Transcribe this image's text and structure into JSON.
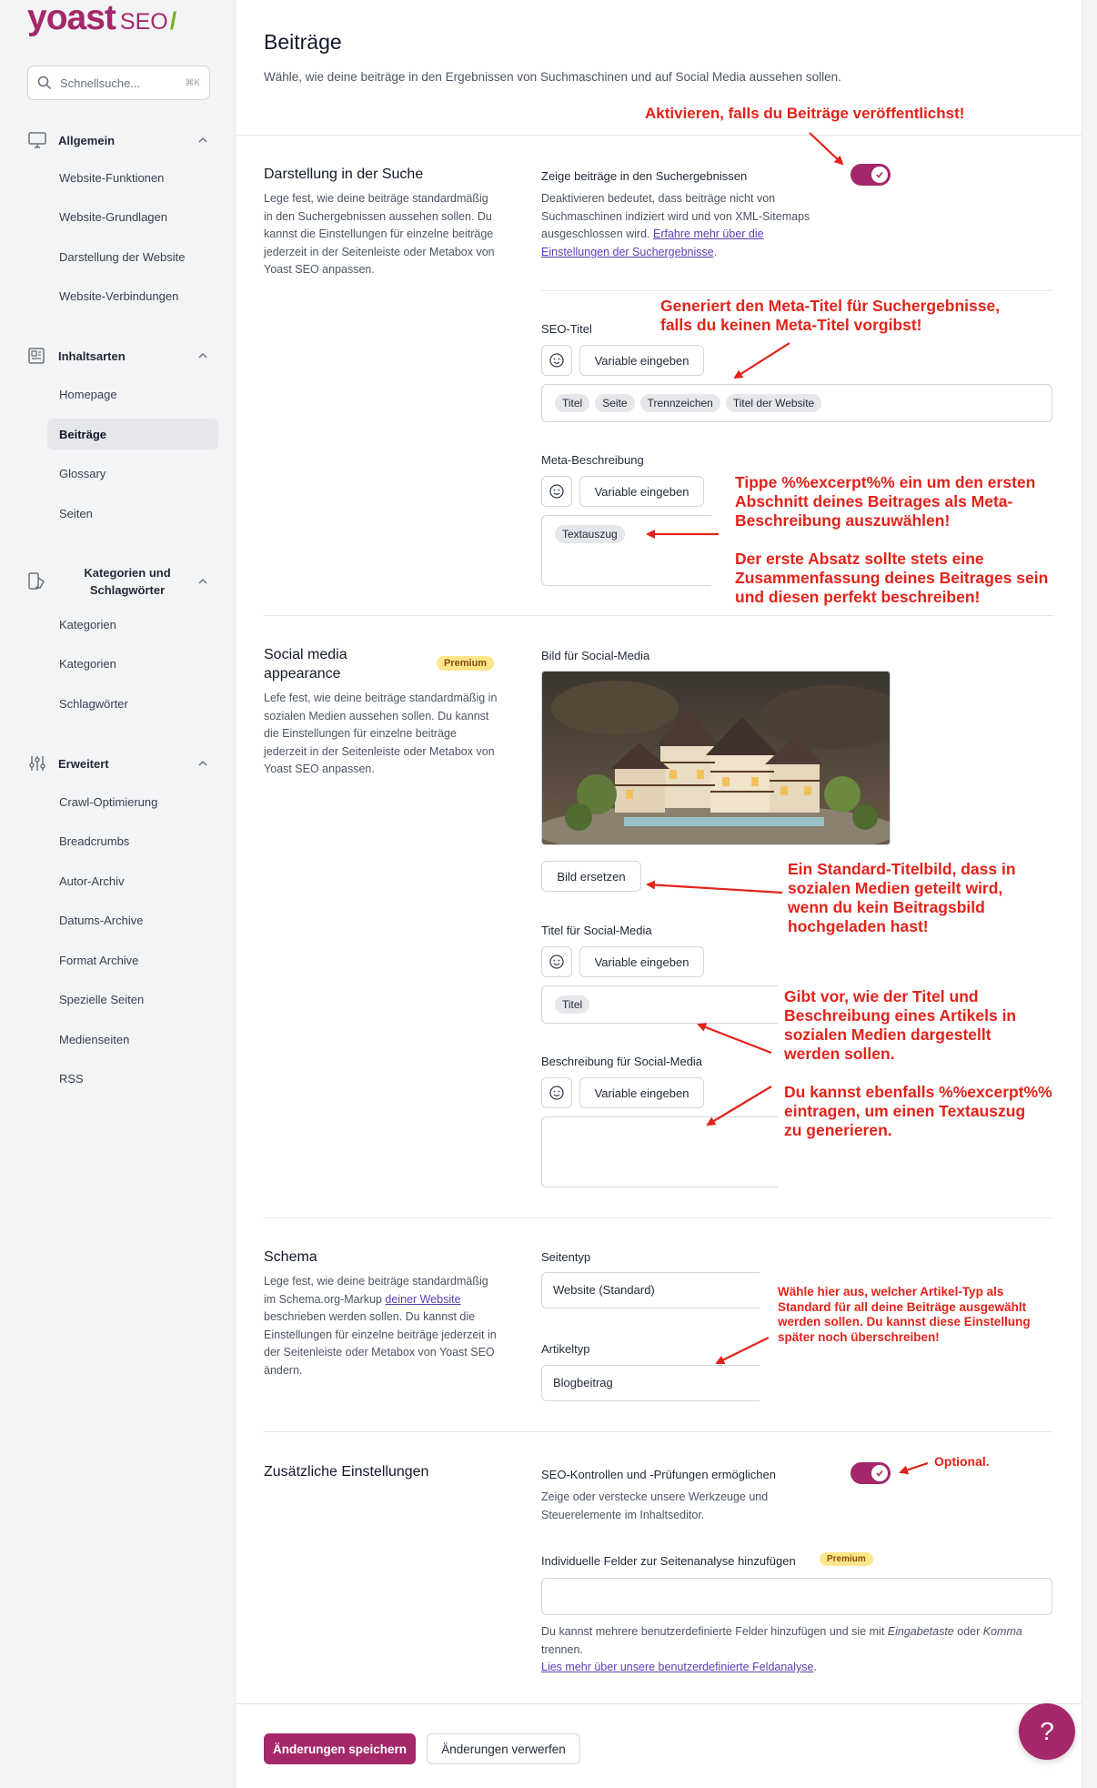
{
  "brand": {
    "logo_main": "yoast",
    "logo_sub": "SEO",
    "logo_slash": "/"
  },
  "search": {
    "placeholder": "Schnellsuche...",
    "shortcut": "⌘K"
  },
  "sidebar": {
    "sections": [
      {
        "label": "Allgemein",
        "icon": "desktop-icon",
        "items": [
          "Website-Funktionen",
          "Website-Grundlagen",
          "Darstellung der Website",
          "Website-Verbindungen"
        ]
      },
      {
        "label": "Inhaltsarten",
        "icon": "newspaper-icon",
        "items": [
          "Homepage",
          "Beiträge",
          "Glossary",
          "Seiten"
        ]
      },
      {
        "label_line1": "Kategorien und",
        "label_line2": "Schlagwörter",
        "icon": "tag-icon",
        "items": [
          "Kategorien",
          "Kategorien",
          "Schlagwörter"
        ]
      },
      {
        "label": "Erweitert",
        "icon": "sliders-icon",
        "items": [
          "Crawl-Optimierung",
          "Breadcrumbs",
          "Autor-Archiv",
          "Datums-Archive",
          "Format Archive",
          "Spezielle Seiten",
          "Medienseiten",
          "RSS"
        ]
      }
    ],
    "active_item": "Beiträge"
  },
  "page": {
    "title": "Beiträge",
    "description": "Wähle, wie deine beiträge in den Ergebnissen von Suchmaschinen und auf Social Media aussehen sollen."
  },
  "search_appearance": {
    "title": "Darstellung in der Suche",
    "description": "Lege fest, wie deine beiträge standardmäßig in den Suchergebnissen aussehen sollen. Du kannst die Einstellungen für einzelne beiträge jederzeit in der Seitenleiste oder Metabox von Yoast SEO anpassen.",
    "toggle_label": "Zeige beiträge in den Suchergebnissen",
    "toggle_on": true,
    "toggle_desc": "Deaktivieren bedeutet, dass beiträge nicht von Suchmaschinen indiziert wird und von XML-Sitemaps ausgeschlossen wird.",
    "toggle_link": "Erfahre mehr über die Einstellungen der Suchergebnisse",
    "seo_title_label": "SEO-Titel",
    "insert_variable": "Variable eingeben",
    "seo_title_tags": [
      "Titel",
      "Seite",
      "Trennzeichen",
      "Titel der Website"
    ],
    "meta_label": "Meta-Beschreibung",
    "meta_tags": [
      "Textauszug"
    ]
  },
  "social": {
    "title": "Social media appearance",
    "badge": "Premium",
    "description": "Lefe fest, wie deine beiträge standardmäßig in sozialen Medien aussehen sollen. Du kannst die Einstellungen für einzelne beiträge jederzeit in der Seitenleiste oder Metabox von Yoast SEO anpassen.",
    "image_label": "Bild für Social-Media",
    "replace_image": "Bild ersetzen",
    "title_label": "Titel für Social-Media",
    "title_tags": [
      "Titel"
    ],
    "desc_label": "Beschreibung für Social-Media",
    "insert_variable": "Variable eingeben"
  },
  "schema": {
    "title": "Schema",
    "description_pre": "Lege fest, wie deine beiträge standardmäßig im Schema.org-Markup",
    "description_link": "deiner Website",
    "description_post": "beschrieben werden sollen. Du kannst die Einstellungen für einzelne beiträge jederzeit in der Seitenleiste oder Metabox von Yoast SEO ändern.",
    "page_type_label": "Seitentyp",
    "page_type_value": "Website (Standard)",
    "article_type_label": "Artikeltyp",
    "article_type_value": "Blogbeitrag"
  },
  "additional": {
    "title": "Zusätzliche Einstellungen",
    "toggle_label": "SEO-Kontrollen und -Prüfungen ermöglichen",
    "toggle_on": true,
    "toggle_desc": "Zeige oder verstecke unsere Werkzeuge und Steuerelemente im Inhaltseditor.",
    "custom_fields_label": "Individuelle Felder zur Seitenanalyse hinzufügen",
    "badge": "Premium",
    "custom_fields_desc_1": "Du kannst mehrere benutzerdefinierte Felder hinzufügen und sie mit",
    "custom_fields_desc_em1": "Eingabetaste",
    "custom_fields_desc_2": "oder",
    "custom_fields_desc_em2": "Komma",
    "custom_fields_desc_3": "trennen.",
    "custom_fields_link": "Lies mehr über unsere benutzerdefinierte Feldanalyse"
  },
  "footer": {
    "save": "Änderungen speichern",
    "discard": "Änderungen verwerfen",
    "help": "?"
  },
  "annotations": {
    "a1": "Aktivieren, falls du Beiträge veröffentlichst!",
    "a2_l1": "Generiert den Meta-Titel für Suchergebnisse,",
    "a2_l2": "falls du keinen Meta-Titel vorgibst!",
    "a3_l1": "Tippe %%excerpt%% ein um den ersten",
    "a3_l2": "Abschnitt deines Beitrages als Meta-",
    "a3_l3": "Beschreibung auszuwählen!",
    "a4_l1": "Der erste Absatz sollte stets eine",
    "a4_l2": "Zusammenfassung deines Beitrages sein",
    "a4_l3": "und diesen perfekt beschreiben!",
    "a5_l1": "Ein Standard-Titelbild, dass in",
    "a5_l2": "sozialen Medien geteilt wird,",
    "a5_l3": "wenn du kein Beitragsbild",
    "a5_l4": "hochgeladen hast!",
    "a6_l1": "Gibt vor, wie der Titel und",
    "a6_l2": "Beschreibung eines Artikels in",
    "a6_l3": "sozialen Medien dargestellt",
    "a6_l4": "werden sollen.",
    "a7_l1": "Du kannst ebenfalls %%excerpt%%",
    "a7_l2": "eintragen, um einen Textauszug",
    "a7_l3": "zu generieren.",
    "a8_l1": "Wähle hier aus, welcher Artikel-Typ als",
    "a8_l2": "Standard für all deine Beiträge ausgewählt",
    "a8_l3": "werden sollen. Du kannst diese Einstellung",
    "a8_l4": "später noch überschreiben!",
    "a9": "Optional."
  },
  "colors": {
    "brand": "#a4286a",
    "annotation": "#e2231a",
    "premium": "#fde68a",
    "link": "#5b3fb5"
  }
}
